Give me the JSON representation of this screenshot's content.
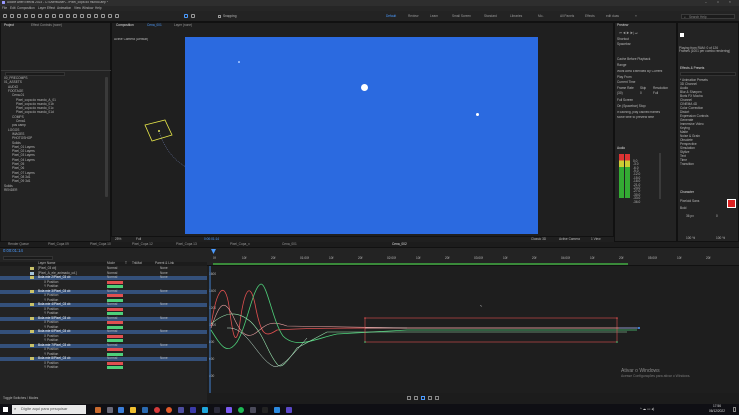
{
  "app": {
    "title": "Adobe After Effects 2023 - C:\\Users\\user\\...\\Pixel_copa do mundo.aep *",
    "menu": [
      "File",
      "Edit",
      "Composition",
      "Layer",
      "Effect",
      "Animation",
      "View",
      "Window",
      "Help"
    ],
    "workspaces": [
      "Default",
      "Review",
      "Learn",
      "Small Screen",
      "Standard",
      "Libraries",
      "Mo..",
      "All Panels",
      "Effects",
      "edit duas"
    ],
    "active_workspace": "Default",
    "search_placeholder": "Search Help",
    "snapping_label": "Snapping"
  },
  "project_panel": {
    "tabs": [
      "Project",
      "Effect Controls (none)"
    ],
    "items": [
      "00_PRECOMPS",
      "01_ASSETS",
      "AUDIO",
      "FOOTAGE",
      "Cena-01",
      "Pixel_copa do mundo_A_01",
      "Pixel_copa do mundo_01b",
      "Pixel_copa do mundo_01c",
      "Pixel_copa do mundo_01d",
      "COMPS",
      "Cena1",
      "pos camp",
      "LOGOS",
      "IMAGES",
      "PHOTOSHOP",
      "Solids",
      "Pixel_01 Layers",
      "Pixel_02 Layers",
      "Pixel_03 Layers",
      "Pixel_04 Layers",
      "Pixel_05",
      "Pixel_06",
      "Pixel_07 Layers",
      "Pixel_08 3d1",
      "Pixel_09 3d1",
      "Solids",
      "RENDER"
    ]
  },
  "composition_viewer": {
    "tabs": [
      "Composition",
      "Layer (none)"
    ],
    "comp_name": "Cena_001",
    "camera_label": "Active Camera (Default)",
    "zoom": "25%",
    "resolution": "Full",
    "timecode": "0:00:01:14",
    "view_camera": "Active Camera",
    "view_count": "1 View",
    "renderer": "Classic 3D"
  },
  "right_panel": {
    "preview_title": "Preview",
    "shortcut_label": "Shortcut",
    "shortcut_value": "Spacebar",
    "cache_text": "Cache Before Playback",
    "range_label": "Range",
    "range_value": "Work Area Extended By Current",
    "play_from_label": "Play From",
    "play_from_value": "Current Time",
    "frame_rate_label": "Frame Rate",
    "frame_rate_value": "(30)",
    "skip_label": "Skip",
    "skip_value": "0",
    "resolution_label": "Resolution",
    "resolution_value": "Full",
    "fullscreen_label": "Full Screen",
    "on_stop_label": "On (Spacebar) Stop:",
    "if_caching_label": "If caching, play cached frames",
    "move_time_label": "Move time to preview time",
    "audio_title": "Audio",
    "audio_levels": [
      "0.0",
      "-3.0",
      "-6.0",
      "-9.0",
      "-12.0",
      "-15.0",
      "-18.0",
      "-21.0",
      "-24.0",
      "-27.0",
      "-30.0",
      "-33.0",
      "-36.0"
    ],
    "info_text": "Playing from RAM: 0 of 126\nFrames (1001 per combo rendering)",
    "effects_title": "Effects & Presets",
    "effects": [
      "* Animation Presets",
      "3D Channel",
      "Audio",
      "Blur & Sharpen",
      "Boris FX Mocha",
      "Channel",
      "CINEMA 4D",
      "Color Correction",
      "Distort",
      "Expression Controls",
      "Generate",
      "Immersive Video",
      "Keying",
      "Matte",
      "Noise & Grain",
      "Obsolete",
      "Perspective",
      "Simulation",
      "Stylize",
      "Text",
      "Time",
      "Transition",
      "Utility"
    ],
    "character_title": "Character",
    "font_name": "Pixeloid Sans",
    "font_style": "Bold",
    "font_size": "36 px",
    "tracking": "0",
    "scale_v": "100 %",
    "scale_h": "100 %"
  },
  "timeline": {
    "tabs": [
      "Render Queue",
      "Pixel_Copa 09",
      "Pixel_Copa 10",
      "Pixel_Copa 12",
      "Pixel_Copa 13",
      "Pixel_Copa_x",
      "Cena_001",
      "Cena_002"
    ],
    "timecode": "0:00:01:14",
    "col_headers": [
      "Layer Name",
      "Mode",
      "T",
      "TrkMat",
      "Parent & Link"
    ],
    "layers": [
      {
        "name": "[Pixel_03 cb]",
        "mode": "Normal",
        "parent": "None"
      },
      {
        "name": "[Pixel_A_ele_animado_cd.]",
        "mode": "Normal",
        "parent": "None"
      },
      {
        "name": "Bola mie 2/Pixel_03 cb",
        "mode": "Normal",
        "parent": "None"
      },
      {
        "name": "X Position",
        "mode": "",
        "parent": ""
      },
      {
        "name": "Y Position",
        "mode": "",
        "parent": ""
      },
      {
        "name": "Bola mie 3/Pixel_03 cb",
        "mode": "Normal",
        "parent": "None"
      },
      {
        "name": "X Position",
        "mode": "",
        "parent": ""
      },
      {
        "name": "Y Position",
        "mode": "",
        "parent": ""
      },
      {
        "name": "Bola mie 4/Pixel_03 cb",
        "mode": "Normal",
        "parent": "None"
      },
      {
        "name": "X Position",
        "mode": "",
        "parent": ""
      },
      {
        "name": "Y Position",
        "mode": "",
        "parent": ""
      },
      {
        "name": "Bola mie 5/Pixel_03 cb",
        "mode": "Normal",
        "parent": "None"
      },
      {
        "name": "X Position",
        "mode": "",
        "parent": ""
      },
      {
        "name": "Y Position",
        "mode": "",
        "parent": ""
      },
      {
        "name": "Bola mie 6/Pixel_03 cb",
        "mode": "Normal",
        "parent": "None"
      },
      {
        "name": "X Position",
        "mode": "",
        "parent": ""
      },
      {
        "name": "Y Position",
        "mode": "",
        "parent": ""
      },
      {
        "name": "Bola mie 7/Pixel_03 cb",
        "mode": "Normal",
        "parent": "None"
      },
      {
        "name": "X Position",
        "mode": "",
        "parent": ""
      },
      {
        "name": "Y Position",
        "mode": "",
        "parent": ""
      },
      {
        "name": "Bola mie 8/Pixel_03 cb",
        "mode": "Normal",
        "parent": "None"
      },
      {
        "name": "X Position",
        "mode": "",
        "parent": ""
      },
      {
        "name": "Y Position",
        "mode": "",
        "parent": ""
      }
    ],
    "ruler": [
      "0f",
      "10f",
      "20f",
      "01:00f",
      "10f",
      "20f",
      "02:00f",
      "10f",
      "20f",
      "03:00f",
      "10f",
      "20f",
      "04:00f",
      "10f",
      "20f",
      "05:00f",
      "10f",
      "20f"
    ],
    "graph_values": [
      "1600",
      "1400",
      "1200",
      "1000",
      "800",
      "600",
      "400"
    ],
    "toggle_label": "Toggle Switches / Modes"
  },
  "watermark": {
    "line1": "Ativar o Windows",
    "line2": "Acesse Configurações para ativar o Windows."
  },
  "taskbar": {
    "search_placeholder": "Digite aqui para pesquisar",
    "time": "17:56",
    "date": "06/12/2022"
  },
  "colors": {
    "canvas_blue": "#2b6ae0",
    "accent": "#4b9bff"
  }
}
